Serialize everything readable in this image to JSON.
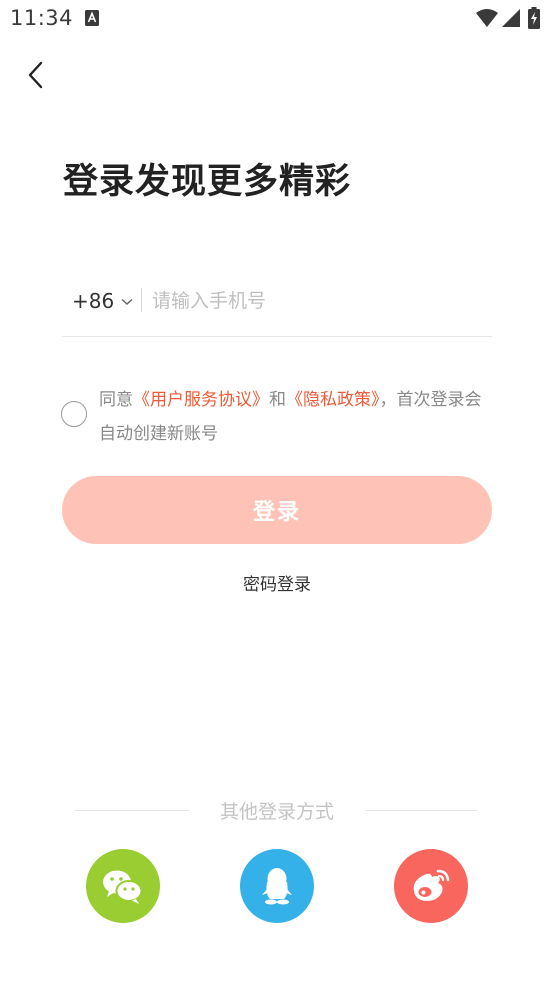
{
  "status_bar": {
    "time": "11:34",
    "notification_icon": "font-download-icon",
    "wifi_icon": "wifi-icon",
    "signal_icon": "cell-signal-icon",
    "battery_icon": "battery-charging-icon"
  },
  "nav": {
    "back_icon": "chevron-left-icon"
  },
  "title": "登录发现更多精彩",
  "phone": {
    "country_code": "+86",
    "placeholder": "请输入手机号",
    "value": ""
  },
  "agreement": {
    "prefix": "同意",
    "user_agreement": "《用户服务协议》",
    "and": "和",
    "privacy_policy": "《隐私政策》",
    "suffix": "，首次登录会自动创建新账号",
    "checked": false
  },
  "login_button": "登录",
  "password_login": "密码登录",
  "other_login": {
    "label": "其他登录方式",
    "providers": [
      {
        "name": "wechat",
        "icon": "wechat-icon",
        "color": "#9acd32"
      },
      {
        "name": "qq",
        "icon": "qq-icon",
        "color": "#35b1ea"
      },
      {
        "name": "weibo",
        "icon": "weibo-icon",
        "color": "#f8665e"
      }
    ]
  },
  "colors": {
    "accent": "#f05a37",
    "login_button_disabled": "#ffc2b6"
  }
}
